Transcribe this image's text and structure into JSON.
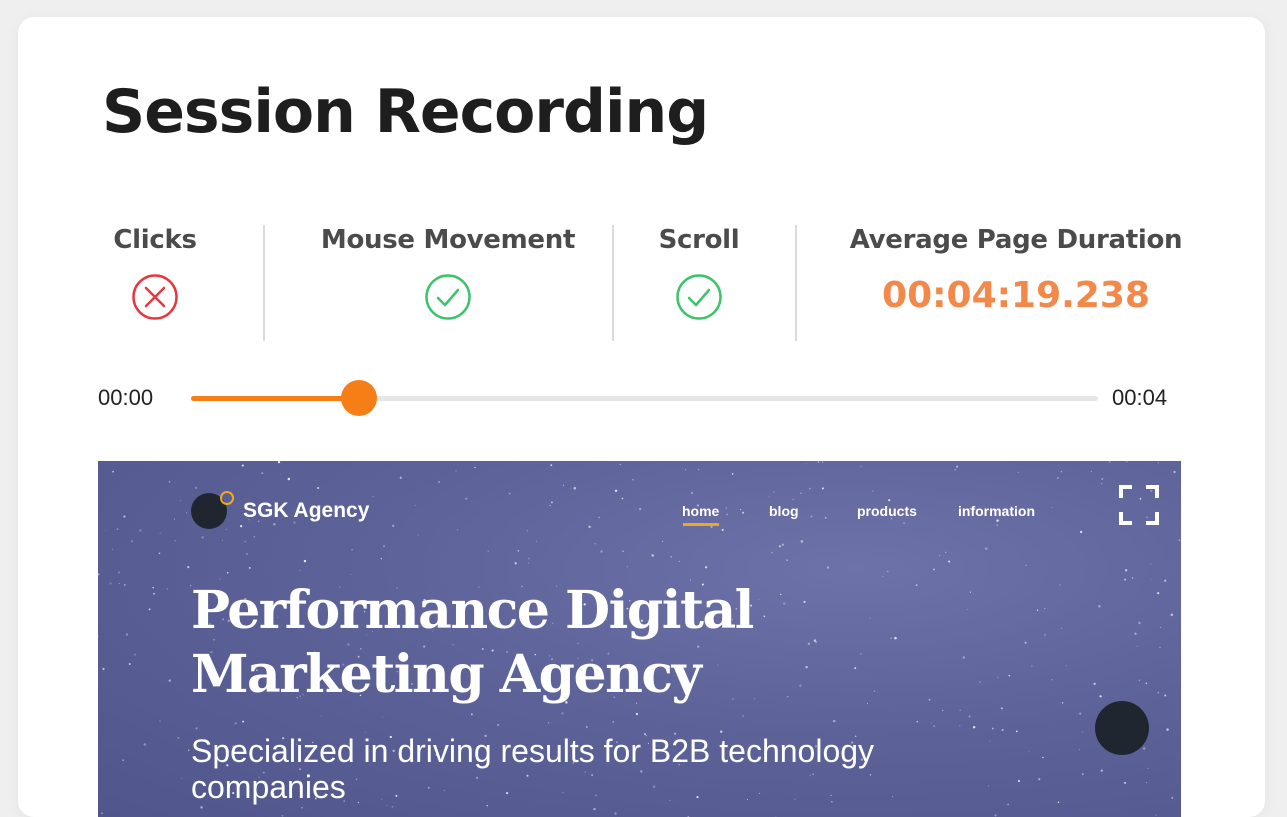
{
  "page": {
    "title": "Session Recording"
  },
  "stats": {
    "clicks": {
      "label": "Clicks",
      "status": "disabled",
      "icon": "x-circle-icon",
      "color": "#e8373f"
    },
    "mouse_movement": {
      "label": "Mouse Movement",
      "status": "enabled",
      "icon": "check-circle-icon",
      "color": "#3cc46b"
    },
    "scroll": {
      "label": "Scroll",
      "status": "enabled",
      "icon": "check-circle-icon",
      "color": "#3cc46b"
    },
    "average_page_duration": {
      "label": "Average Page Duration",
      "value": "00:04:19.238",
      "color": "#f2894a"
    }
  },
  "player": {
    "start_time": "00:00",
    "end_time": "00:04",
    "progress": 0.185,
    "accent_color": "#f57f16"
  },
  "preview": {
    "brand": "SGK Agency",
    "nav": [
      {
        "label": "home",
        "active": true
      },
      {
        "label": "blog",
        "active": false
      },
      {
        "label": "products",
        "active": false
      },
      {
        "label": "information",
        "active": false
      }
    ],
    "hero_title_line1": "Performance Digital",
    "hero_title_line2": "Marketing Agency",
    "hero_subtitle": "Specialized in driving results for B2B technology companies",
    "fullscreen_icon": "fullscreen-icon",
    "chat_icon": "chat-bubble-icon"
  }
}
